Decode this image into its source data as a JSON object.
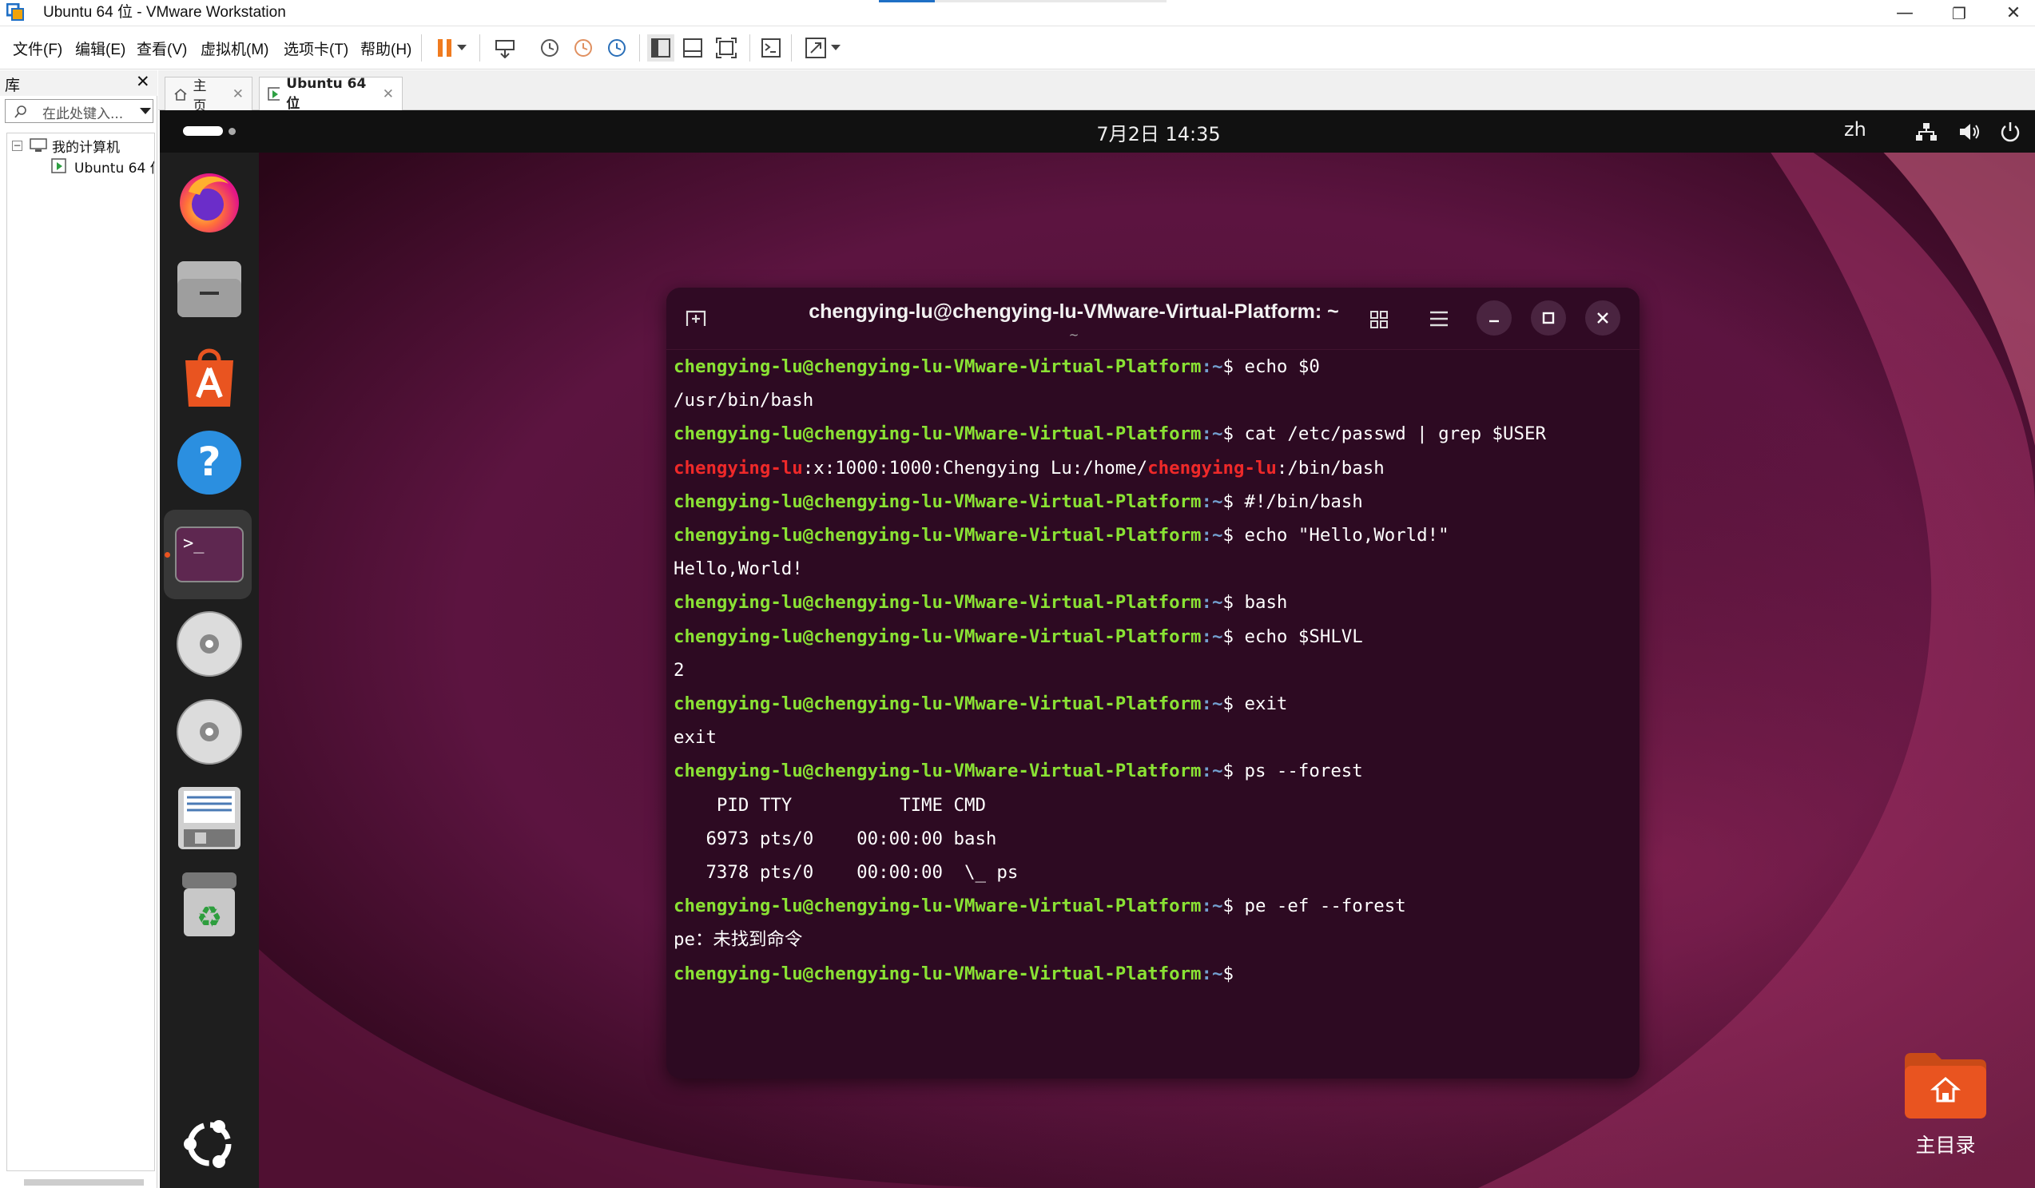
{
  "window": {
    "title": "Ubuntu 64 位 - VMware Workstation",
    "min_glyph": "—",
    "restore_glyph": "❐",
    "close_glyph": "✕"
  },
  "menu": {
    "file": "文件(F)",
    "edit": "编辑(E)",
    "view": "查看(V)",
    "vm": "虚拟机(M)",
    "tabs": "选项卡(T)",
    "help": "帮助(H)"
  },
  "library": {
    "title": "库",
    "close": "✕",
    "search_placeholder": "在此处键入...",
    "root": "我的计算机",
    "vm_item": "Ubuntu 64 位"
  },
  "tabs": {
    "home": "主页",
    "vm": "Ubuntu 64 位"
  },
  "ubuntu": {
    "clock": "7月2日  14:35",
    "lang": "zh",
    "desktop_folder": "主目录"
  },
  "terminal": {
    "title": "chengying-lu@chengying-lu-VMware-Virtual-Platform: ~",
    "subtitle": "~",
    "prompt_user": "chengying-lu@chengying-lu-VMware-Virtual-Platform",
    "prompt_suffix": ":~$",
    "lines": [
      {
        "type": "cmd",
        "text": " echo $0"
      },
      {
        "type": "out",
        "text": "/usr/bin/bash"
      },
      {
        "type": "cmd",
        "text": " cat /etc/passwd | grep $USER"
      },
      {
        "type": "passwd",
        "a": "chengying-lu",
        "b": ":x:1000:1000:Chengying Lu:/home/",
        "c": "chengying-lu",
        "d": ":/bin/bash"
      },
      {
        "type": "cmd",
        "text": " #!/bin/bash"
      },
      {
        "type": "cmd",
        "text": " echo \"Hello,World!\""
      },
      {
        "type": "out",
        "text": "Hello,World!"
      },
      {
        "type": "cmd",
        "text": " bash"
      },
      {
        "type": "cmd",
        "text": " echo $SHLVL"
      },
      {
        "type": "out",
        "text": "2"
      },
      {
        "type": "cmd",
        "text": " exit"
      },
      {
        "type": "out",
        "text": "exit"
      },
      {
        "type": "cmd",
        "text": " ps --forest"
      },
      {
        "type": "out",
        "text": "    PID TTY          TIME CMD"
      },
      {
        "type": "out",
        "text": "   6973 pts/0    00:00:00 bash"
      },
      {
        "type": "out",
        "text": "   7378 pts/0    00:00:00  \\_ ps"
      },
      {
        "type": "cmd",
        "text": " pe -ef --forest"
      },
      {
        "type": "out",
        "text": "pe：未找到命令"
      },
      {
        "type": "cmd",
        "text": ""
      }
    ]
  },
  "colors": {
    "prompt_green": "#8ae234",
    "prompt_blue": "#729fcf",
    "user_red": "#ef2929",
    "terminal_bg": "#2d0a22",
    "dock_bg": "#1e1e1e"
  },
  "icons": [
    "firefox-icon",
    "files-icon",
    "app-center-icon",
    "help-icon",
    "terminal-icon",
    "disc-icon",
    "disc-icon",
    "text-editor-icon",
    "trash-icon",
    "ubuntu-logo-icon",
    "network-icon",
    "volume-icon",
    "power-icon",
    "home-folder-icon"
  ]
}
